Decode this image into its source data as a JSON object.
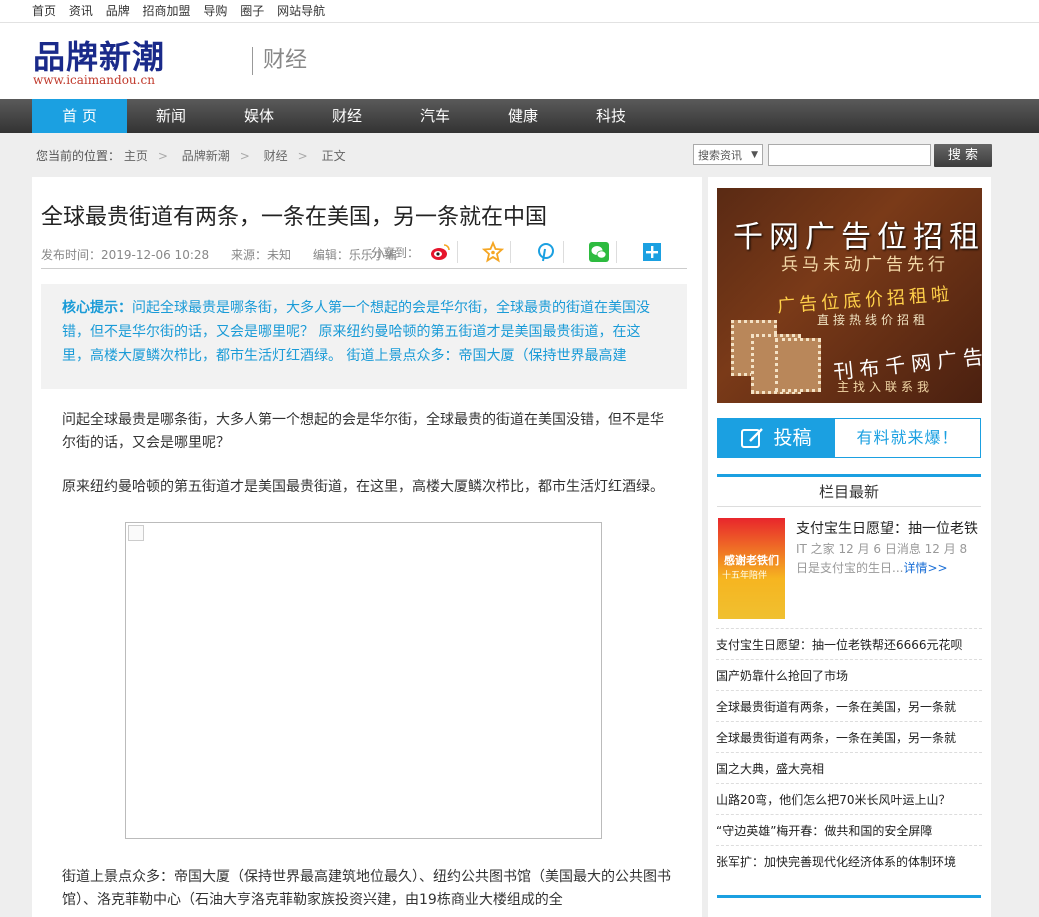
{
  "topnav": [
    "首页",
    "资讯",
    "品牌",
    "招商加盟",
    "导购",
    "圈子",
    "网站导航"
  ],
  "logo": {
    "main": "品牌新潮",
    "url": "www.icaimandou.cn"
  },
  "channel": "财经",
  "nav": [
    "首 页",
    "新闻",
    "娱体",
    "财经",
    "汽车",
    "健康",
    "科技"
  ],
  "breadcrumb": {
    "label": "您当前的位置：",
    "items": [
      "主页",
      "品牌新潮",
      "财经",
      "正文"
    ]
  },
  "search": {
    "select_value": "搜索资讯",
    "button": "搜 索"
  },
  "article": {
    "title": "全球最贵街道有两条，一条在美国，另一条就在中国",
    "publish": "发布时间：2019-12-06 10:28",
    "source": "来源：未知",
    "editor": "编辑：乐乐小编",
    "share_label": "分享到：",
    "summary_label": "核心提示：",
    "summary": "问起全球最贵是哪条街，大多人第一个想起的会是华尔街，全球最贵的街道在美国没错，但不是华尔街的话，又会是哪里呢？ 原来纽约曼哈顿的第五街道才是美国最贵街道，在这里，高楼大厦鳞次栉比，都市生活灯红酒绿。 街道上景点众多：帝国大厦（保持世界最高建",
    "p1": "问起全球最贵是哪条街，大多人第一个想起的会是华尔街，全球最贵的街道在美国没错，但不是华尔街的话，又会是哪里呢？",
    "p2": "原来纽约曼哈顿的第五街道才是美国最贵街道，在这里，高楼大厦鳞次栉比，都市生活灯红酒绿。",
    "p3": "街道上景点众多：帝国大厦（保持世界最高建筑地位最久）、纽约公共图书馆（美国最大的公共图书馆）、洛克菲勒中心（石油大亨洛克菲勒家族投资兴建，由19栋商业大楼组成的全"
  },
  "ad": {
    "line1": "千网广告位招租",
    "line2": "兵马未动广告先行",
    "line3": "广告位底价招租啦",
    "line4": "直接热线价招租",
    "line5": "刊布千网广告",
    "line6": "主找入联系我"
  },
  "submit": {
    "left": "投稿",
    "right": "有料就来爆！"
  },
  "sidebar": {
    "section_title": "栏目最新",
    "featured": {
      "img_text1": "感谢老铁们",
      "img_text2": "十五年陪伴",
      "title": "支付宝生日愿望：抽一位老铁",
      "desc": "IT 之家 12 月 6 日消息 12 月 8 日是支付宝的生日...",
      "more": "详情>>"
    },
    "list": [
      "支付宝生日愿望：抽一位老铁帮还6666元花呗",
      "国产奶靠什么抢回了市场",
      "全球最贵街道有两条，一条在美国，另一条就",
      "全球最贵街道有两条，一条在美国，另一条就",
      "国之大典，盛大亮相",
      "山路20弯，他们怎么把70米长风叶运上山？",
      "“守边英雄”梅开春：做共和国的安全屏障",
      "张军扩：加快完善现代化经济体系的体制环境"
    ]
  },
  "colors": {
    "accent": "#1ba0e1",
    "summary_text": "#1a9bd7",
    "nav_bg": "#3c3c3c"
  }
}
